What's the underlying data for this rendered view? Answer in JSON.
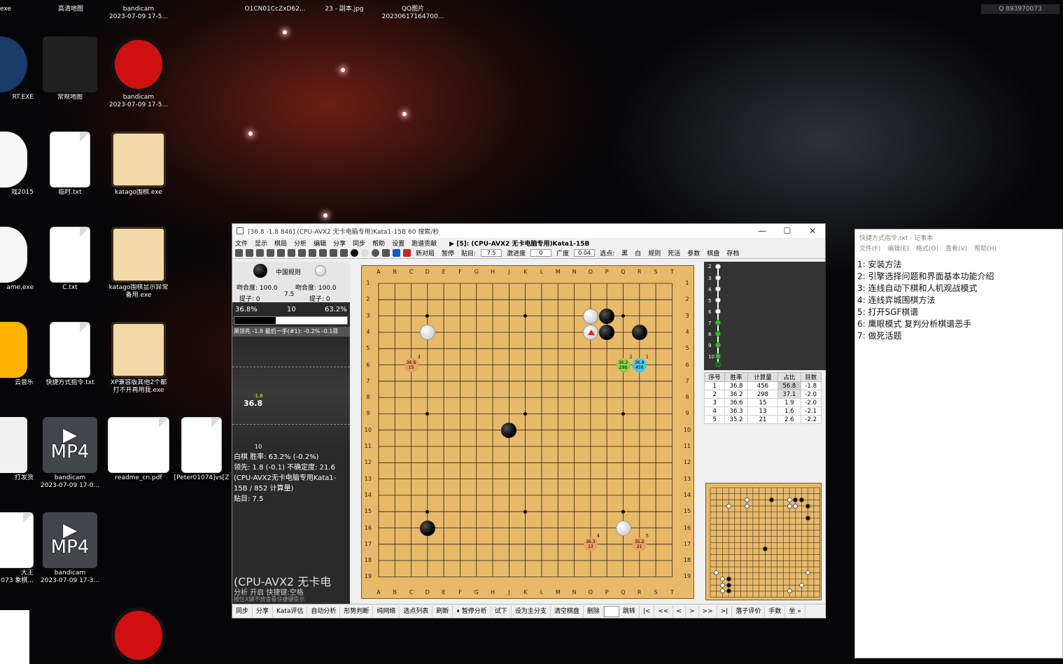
{
  "desktop": {
    "top_labels": [
      {
        "text": "exe"
      },
      {
        "text": "高清地图"
      },
      {
        "text": "bandicam\n2023-07-09 17-5..."
      },
      {
        "text": "O1CN01CcZxD62..."
      },
      {
        "text": "23 - 副本.jpg"
      },
      {
        "text": "QQ图片\n20230617164700..."
      }
    ],
    "icons": [
      {
        "label": "RT.EXE"
      },
      {
        "label": "常规地图"
      },
      {
        "label": "bandicam\n2023-07-09 17-5..."
      },
      {
        "label": "戏2015"
      },
      {
        "label": "临时.txt"
      },
      {
        "label": "katago围棋.exe"
      },
      {
        "label": "ame.exe"
      },
      {
        "label": "C.txt"
      },
      {
        "label": "katago围棋显示异常\n备用.exe"
      },
      {
        "label": "云音乐"
      },
      {
        "label": "快捷方式指令.txt"
      },
      {
        "label": "XP兼容版其他2个都\n打不开再用我.exe"
      },
      {
        "label": "打发货"
      },
      {
        "label": "bandicam\n2023-07-09 17-0..."
      },
      {
        "label": "readme_cn.pdf"
      },
      {
        "label": "[Peter01074]vs[Z"
      },
      {
        "label": "大王\n073 象棋..."
      },
      {
        "label": "bandicam\n2023-07-09 17-3..."
      }
    ],
    "mp4_text": "MP4",
    "watermark": "Q 893970073"
  },
  "app": {
    "title": "[36.8 -1.8 846] (CPU-AVX2 无卡电脑专用)Kata1-15B 60 搜索/秒",
    "menu": [
      "文件",
      "显示",
      "棋局",
      "分析",
      "编辑",
      "分享",
      "同步",
      "帮助",
      "设置",
      "跑谱贡献"
    ],
    "menu_context": "▶ [5]: (CPU-AVX2 无卡电脑专用)Kata1-15B",
    "toolbar": {
      "new_game": "新对局",
      "pause": "暂停",
      "komi_label": "贴目:",
      "komi_value": "7.5",
      "progress_label": "激进度",
      "progress_value": "0",
      "width_label": "广度",
      "width_value": "0.04",
      "pick_label": "选点:",
      "black_label": "黑",
      "white_label": "白",
      "rules": "规则",
      "deadstone": "死活",
      "params": "参数",
      "board": "棋盘",
      "save": "存档"
    },
    "left": {
      "rule": "中国规则",
      "black_match": "吻合度: 100.0",
      "white_match": "吻合度: 100.0",
      "komi_center": "7.5",
      "black_captures": "提子: 0",
      "white_captures": "提子: 0",
      "winrate_black": "36.8%",
      "winrate_mid": "10",
      "winrate_white": "63.2%",
      "winrate_black_frac": 0.368,
      "last_move_line": "黑领先 -1.8 最后一手(#1): -0.2% -0.1目",
      "graph_value": "36.8",
      "graph_tick": "-1.8",
      "graph_x": "10",
      "info_lines": [
        "白棋 胜率: 63.2% (-0.2%)",
        "领先: 1.8 (-0.1) 不确定度: 21.6",
        "(CPU-AVX2无卡电脑专用Kata1-",
        "15B / 852 计算量)",
        "贴目: 7.5"
      ],
      "engine_big": "(CPU-AVX2 无卡电",
      "hint1": "分析 开启  快捷键:空格",
      "hint2": "按住X键不放查看快捷键提示"
    },
    "board": {
      "cols": [
        "A",
        "B",
        "C",
        "D",
        "E",
        "F",
        "G",
        "H",
        "J",
        "K",
        "L",
        "M",
        "N",
        "O",
        "P",
        "Q",
        "R",
        "S",
        "T"
      ],
      "rows": [
        "1",
        "2",
        "3",
        "4",
        "5",
        "6",
        "7",
        "8",
        "9",
        "10",
        "11",
        "12",
        "13",
        "14",
        "15",
        "16",
        "17",
        "18",
        "19"
      ],
      "black_stones": [
        [
          14,
          3
        ],
        [
          15,
          3
        ],
        [
          17,
          4
        ],
        [
          9,
          10
        ],
        [
          4,
          16
        ],
        [
          15,
          4
        ]
      ],
      "white_stones": [
        [
          4,
          4
        ],
        [
          14,
          4
        ],
        [
          14,
          3
        ],
        [
          16,
          16
        ]
      ],
      "last_move": [
        14,
        4
      ],
      "candidates": [
        {
          "col": 17,
          "row": 6,
          "wr": "36.8",
          "po": "456",
          "rank": "1",
          "color": "#4cc3e6"
        },
        {
          "col": 16,
          "row": 6,
          "wr": "36.2",
          "po": "298",
          "rank": "2",
          "color": "#8ed147"
        },
        {
          "col": 3,
          "row": 6,
          "wr": "36.6",
          "po": "15",
          "rank": "3",
          "color": "#e8a060"
        },
        {
          "col": 14,
          "row": 17,
          "wr": "36.3",
          "po": "13",
          "rank": "4",
          "color": "#e8a060"
        },
        {
          "col": 17,
          "row": 17,
          "wr": "35.2",
          "po": "21",
          "rank": "5",
          "color": "#e8a060"
        }
      ]
    },
    "tree_labels": [
      "2",
      "3",
      "4",
      "5",
      "6",
      "7",
      "8",
      "9",
      "10"
    ],
    "analysis_table": {
      "headers": [
        "序号",
        "胜率",
        "计算量",
        "占比",
        "目数"
      ],
      "rows": [
        [
          "1",
          "36.8",
          "456",
          "56.8",
          "-1.8"
        ],
        [
          "2",
          "36.2",
          "298",
          "37.1",
          "-2.0"
        ],
        [
          "3",
          "36.6",
          "15",
          "1.9",
          "-2.0"
        ],
        [
          "4",
          "36.3",
          "13",
          "1.6",
          "-2.1"
        ],
        [
          "5",
          "35.2",
          "21",
          "2.6",
          "-2.2"
        ]
      ]
    },
    "bottom": [
      "同步",
      "分享",
      "Kata评估",
      "自动分析",
      "形势判断",
      "纯网络",
      "选点列表",
      "刷新",
      "⏸ 暂停分析",
      "试下",
      "设为主分支",
      "清空棋盘",
      "删除",
      "跳转",
      "|<",
      "<<",
      "<",
      ">",
      ">>",
      ">|",
      "落子评价",
      "手数",
      "坐 »"
    ]
  },
  "notepad": {
    "title": "快捷方式指令.txt - 记事本",
    "menu": [
      "文件(F)",
      "编辑(E)",
      "格式(O)",
      "查看(V)",
      "帮助(H)"
    ],
    "lines": [
      "1:  安装方法",
      "2:  引擎选择问题和界面基本功能介绍",
      "3:  连线自动下棋和人机观战模式",
      "4:  连线弈城围棋方法",
      "5:  打开SGF棋谱",
      "6:  鹰眼模式 复判分析棋谱恶手",
      "7:  做死活题"
    ]
  },
  "colors": {
    "candidate_best": "#4cc3e6",
    "candidate_second": "#8ed147",
    "candidate_other": "#e8a060",
    "board": "#e8b968"
  }
}
